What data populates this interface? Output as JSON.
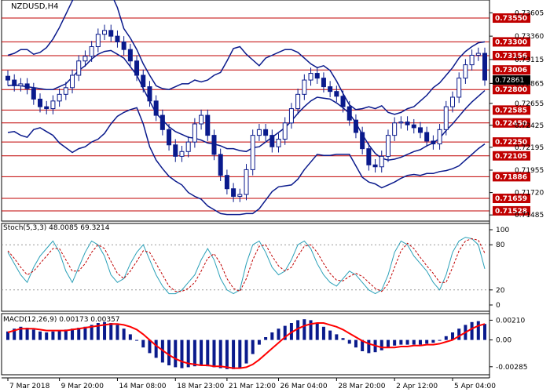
{
  "symbol": "NZDUSD,H4",
  "stoch_label": "Stoch(5,3,3) 48.0085 69.3214",
  "macd_label": "MACD(12,26,9) 0.00173 0.00357",
  "current_price": "0.72861",
  "colors": {
    "background": "#ffffff",
    "candle": "#0a1a8c",
    "bollinger": "#0a1a8c",
    "level_line": "#c00000",
    "level_label_bg": "#c00000",
    "stoch_main": "#2aa0b8",
    "stoch_signal": "#c00000",
    "macd_hist": "#0a1a8c",
    "macd_signal": "#ff0000",
    "current_label_bg": "#000000"
  },
  "price_levels": [
    "0.73550",
    "0.73300",
    "0.73156",
    "0.73006",
    "0.72800",
    "0.72585",
    "0.72450",
    "0.72250",
    "0.72105",
    "0.71886",
    "0.71659",
    "0.71528"
  ],
  "price_ticks": [
    "0.73605",
    "0.73360",
    "0.73115",
    "0.72865",
    "0.72655",
    "0.72425",
    "0.72195",
    "0.71955",
    "0.71720",
    "0.71485"
  ],
  "stoch_ticks": [
    "100",
    "80",
    "20",
    "0"
  ],
  "macd_ticks": [
    "0.00210",
    "0.00",
    "-0.00285"
  ],
  "time_labels": [
    "7 Mar 2018",
    "9 Mar 20:00",
    "14 Mar 08:00",
    "18 Mar 23:00",
    "21 Mar 12:00",
    "26 Mar 04:00",
    "28 Mar 20:00",
    "2 Apr 12:00",
    "5 Apr 04:00"
  ],
  "chart_data": [
    {
      "type": "candlestick",
      "title": "NZDUSD,H4",
      "ylim": [
        0.7147,
        0.7369
      ],
      "horizontal_levels": [
        0.7355,
        0.733,
        0.73156,
        0.73006,
        0.728,
        0.72585,
        0.7245,
        0.7225,
        0.72105,
        0.71886,
        0.71659,
        0.71528
      ],
      "close": [
        0.729,
        0.7284,
        0.7286,
        0.7281,
        0.727,
        0.7262,
        0.726,
        0.7268,
        0.7275,
        0.7282,
        0.7295,
        0.731,
        0.7315,
        0.7325,
        0.7338,
        0.7342,
        0.7336,
        0.733,
        0.7322,
        0.731,
        0.7295,
        0.7283,
        0.7268,
        0.7253,
        0.7238,
        0.7222,
        0.721,
        0.7215,
        0.7225,
        0.7244,
        0.7253,
        0.7232,
        0.7212,
        0.719,
        0.7176,
        0.7168,
        0.717,
        0.7196,
        0.7232,
        0.7238,
        0.7232,
        0.722,
        0.7228,
        0.7245,
        0.726,
        0.7275,
        0.729,
        0.7297,
        0.7292,
        0.7283,
        0.7278,
        0.7273,
        0.7262,
        0.7248,
        0.7235,
        0.7218,
        0.7201,
        0.7199,
        0.721,
        0.7232,
        0.7245,
        0.7246,
        0.7243,
        0.724,
        0.7235,
        0.7226,
        0.7223,
        0.7238,
        0.7262,
        0.7272,
        0.7292,
        0.7306,
        0.7316,
        0.7318,
        0.729
      ],
      "bollinger_upper": [
        0.7316,
        0.7318,
        0.7322,
        0.7322,
        0.7317,
        0.7319,
        0.7324,
        0.7333,
        0.7345,
        0.7359,
        0.7373,
        0.7381,
        0.7379,
        0.7379,
        0.7385,
        0.7395,
        0.7381,
        0.7366,
        0.7344,
        0.7334,
        0.7322,
        0.7307,
        0.7295,
        0.7284,
        0.7281,
        0.728,
        0.7283,
        0.7286,
        0.7286,
        0.729,
        0.7288,
        0.729,
        0.7295,
        0.7298,
        0.731,
        0.7323,
        0.7325,
        0.7317,
        0.7311,
        0.7305,
        0.7313,
        0.7316,
        0.7319,
        0.7322,
        0.7322,
        0.7319,
        0.7313,
        0.7307,
        0.7303,
        0.7305,
        0.73,
        0.7289,
        0.7276,
        0.7264,
        0.7259,
        0.726,
        0.7262,
        0.726,
        0.7263,
        0.7256,
        0.7254,
        0.7256,
        0.726,
        0.7262,
        0.7268,
        0.7274,
        0.7282,
        0.7287,
        0.7295,
        0.7303,
        0.7313,
        0.732,
        0.7325,
        0.7329,
        0.733
      ],
      "bollinger_middle": [
        0.7284,
        0.7285,
        0.7284,
        0.7283,
        0.7282,
        0.7281,
        0.728,
        0.728,
        0.7283,
        0.7286,
        0.7293,
        0.73,
        0.7305,
        0.7312,
        0.7317,
        0.732,
        0.7321,
        0.7317,
        0.7313,
        0.7304,
        0.7295,
        0.7281,
        0.7268,
        0.7255,
        0.7248,
        0.7241,
        0.7236,
        0.7233,
        0.723,
        0.7229,
        0.7227,
        0.7224,
        0.7223,
        0.7221,
        0.7218,
        0.7218,
        0.7216,
        0.7215,
        0.7219,
        0.722,
        0.7225,
        0.723,
        0.7235,
        0.724,
        0.7247,
        0.7255,
        0.7262,
        0.7268,
        0.7272,
        0.7271,
        0.727,
        0.7266,
        0.7261,
        0.7255,
        0.7245,
        0.7233,
        0.7222,
        0.7213,
        0.7208,
        0.7206,
        0.7207,
        0.7209,
        0.7212,
        0.7215,
        0.7217,
        0.7221,
        0.7224,
        0.7229,
        0.7237,
        0.7244,
        0.7252,
        0.726,
        0.7267,
        0.7273,
        0.7279
      ],
      "bollinger_lower": [
        0.7235,
        0.7236,
        0.7232,
        0.723,
        0.7238,
        0.724,
        0.7236,
        0.7232,
        0.7224,
        0.7219,
        0.7214,
        0.7218,
        0.722,
        0.7225,
        0.7228,
        0.7234,
        0.7244,
        0.7252,
        0.7256,
        0.7259,
        0.7261,
        0.7244,
        0.722,
        0.7206,
        0.7197,
        0.7189,
        0.7184,
        0.718,
        0.7172,
        0.7168,
        0.7165,
        0.7158,
        0.7154,
        0.715,
        0.7149,
        0.7149,
        0.7149,
        0.715,
        0.715,
        0.7155,
        0.7164,
        0.7173,
        0.7178,
        0.7179,
        0.718,
        0.7186,
        0.7196,
        0.7204,
        0.7212,
        0.7211,
        0.7211,
        0.7212,
        0.7212,
        0.7212,
        0.72,
        0.7188,
        0.7183,
        0.7181,
        0.7177,
        0.718,
        0.7183,
        0.7187,
        0.719,
        0.7191,
        0.719,
        0.7192,
        0.7192,
        0.7194,
        0.7195,
        0.7197,
        0.72,
        0.7206,
        0.7212,
        0.7218,
        0.7223
      ],
      "ylabel_ticks": [
        0.73605,
        0.7336,
        0.73115,
        0.72865,
        0.72655,
        0.72425,
        0.72195,
        0.71955,
        0.7172,
        0.71485
      ]
    },
    {
      "type": "line",
      "title": "Stoch(5,3,3) 48.0085 69.3214",
      "ylim": [
        0,
        100
      ],
      "levels": [
        80,
        20
      ],
      "series": [
        {
          "name": "main",
          "values": [
            70,
            55,
            40,
            30,
            50,
            65,
            75,
            85,
            70,
            45,
            30,
            50,
            70,
            85,
            80,
            65,
            40,
            30,
            35,
            55,
            70,
            80,
            60,
            40,
            25,
            15,
            15,
            20,
            30,
            40,
            60,
            75,
            60,
            35,
            20,
            15,
            20,
            55,
            80,
            85,
            70,
            50,
            40,
            45,
            60,
            80,
            85,
            75,
            55,
            40,
            30,
            25,
            35,
            45,
            40,
            30,
            20,
            15,
            20,
            40,
            70,
            85,
            80,
            65,
            55,
            45,
            30,
            20,
            40,
            70,
            85,
            90,
            88,
            80,
            48
          ]
        },
        {
          "name": "signal",
          "values": [
            72,
            62,
            50,
            40,
            45,
            55,
            65,
            75,
            75,
            60,
            45,
            45,
            55,
            70,
            80,
            75,
            58,
            42,
            35,
            45,
            58,
            72,
            70,
            55,
            40,
            25,
            18,
            18,
            22,
            30,
            45,
            62,
            68,
            55,
            35,
            22,
            18,
            35,
            60,
            78,
            80,
            65,
            52,
            45,
            50,
            65,
            78,
            80,
            70,
            55,
            42,
            33,
            32,
            38,
            42,
            38,
            30,
            22,
            18,
            28,
            50,
            72,
            82,
            75,
            63,
            52,
            42,
            30,
            30,
            50,
            72,
            85,
            88,
            86,
            69
          ]
        }
      ]
    },
    {
      "type": "bar",
      "title": "MACD(12,26,9) 0.00173 0.00357",
      "ylim": [
        -0.0032,
        0.0023
      ],
      "series": [
        {
          "name": "histogram",
          "values": [
            0.0009,
            0.0012,
            0.0014,
            0.0013,
            0.0011,
            0.0009,
            0.0008,
            0.0009,
            0.001,
            0.0011,
            0.0012,
            0.0013,
            0.0014,
            0.0016,
            0.0018,
            0.0019,
            0.0018,
            0.0016,
            0.0012,
            0.0006,
            0.0,
            -0.0008,
            -0.0014,
            -0.0019,
            -0.0024,
            -0.0027,
            -0.0029,
            -0.003,
            -0.0029,
            -0.0028,
            -0.0027,
            -0.0028,
            -0.0029,
            -0.003,
            -0.0031,
            -0.0031,
            -0.003,
            -0.0025,
            -0.0015,
            -0.0005,
            0.0003,
            0.0008,
            0.0012,
            0.0015,
            0.0018,
            0.0021,
            0.0022,
            0.0021,
            0.0018,
            0.0014,
            0.001,
            0.0006,
            0.0002,
            -0.0004,
            -0.0008,
            -0.0012,
            -0.0014,
            -0.0013,
            -0.0011,
            -0.0008,
            -0.0006,
            -0.0005,
            -0.0005,
            -0.0005,
            -0.0005,
            -0.0004,
            -0.0003,
            0.0,
            0.0004,
            0.0008,
            0.0012,
            0.0016,
            0.0019,
            0.002,
            0.0017
          ]
        },
        {
          "name": "signal",
          "values": [
            0.0008,
            0.001,
            0.0012,
            0.0012,
            0.0012,
            0.0011,
            0.001,
            0.001,
            0.001,
            0.001,
            0.0011,
            0.0012,
            0.0013,
            0.0014,
            0.0015,
            0.0016,
            0.0017,
            0.0017,
            0.0016,
            0.0014,
            0.0011,
            0.0006,
            0.0,
            -0.0006,
            -0.0011,
            -0.0016,
            -0.002,
            -0.0023,
            -0.0025,
            -0.0026,
            -0.0027,
            -0.0027,
            -0.0028,
            -0.0028,
            -0.0029,
            -0.003,
            -0.003,
            -0.0029,
            -0.0026,
            -0.0021,
            -0.0015,
            -0.0009,
            -0.0003,
            0.0003,
            0.0008,
            0.0012,
            0.0015,
            0.0017,
            0.0018,
            0.0018,
            0.0016,
            0.0014,
            0.0011,
            0.0007,
            0.0003,
            -0.0001,
            -0.0004,
            -0.0006,
            -0.0008,
            -0.0008,
            -0.0008,
            -0.0007,
            -0.0007,
            -0.0006,
            -0.0006,
            -0.0005,
            -0.0005,
            -0.0004,
            -0.0002,
            0.0,
            0.0004,
            0.0008,
            0.0012,
            0.0015,
            0.0017
          ]
        }
      ]
    }
  ]
}
